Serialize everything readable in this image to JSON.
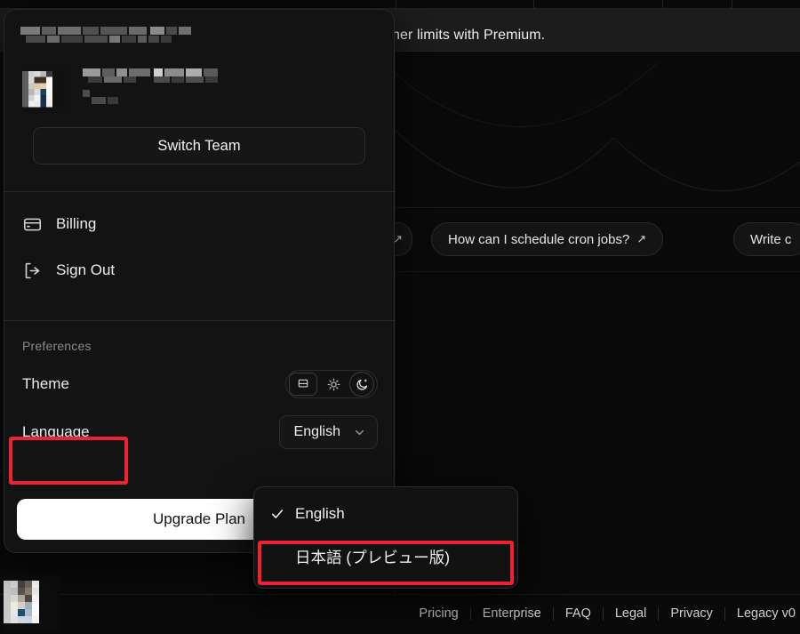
{
  "app": {
    "banner_text": "gher limits with Premium.",
    "suggestion_chips": [
      {
        "label": "",
        "icon": "arrow-up-right-icon"
      },
      {
        "label": "How can I schedule cron jobs?",
        "icon": "arrow-up-right-icon"
      },
      {
        "label": "Write c",
        "icon": ""
      }
    ]
  },
  "account_panel": {
    "team_name_redacted": "",
    "user_name_redacted": "",
    "user_email_redacted": "",
    "switch_team_label": "Switch Team",
    "menu_items": [
      {
        "label": "Billing",
        "icon": "credit-card-icon"
      },
      {
        "label": "Sign Out",
        "icon": "sign-out-icon"
      }
    ],
    "preferences_heading": "Preferences",
    "theme": {
      "label": "Theme",
      "options": [
        {
          "name": "system",
          "icon": "monitor-icon"
        },
        {
          "name": "light",
          "icon": "sun-icon"
        },
        {
          "name": "dark",
          "icon": "moon-icon"
        }
      ],
      "selected": "dark"
    },
    "language": {
      "label": "Language",
      "selected": "English",
      "chevron_icon": "chevron-down-icon"
    },
    "upgrade_label": "Upgrade Plan"
  },
  "language_menu": {
    "options": [
      {
        "label": "English",
        "checked": true,
        "check_icon": "check-icon"
      },
      {
        "label": "日本語 (プレビュー版)",
        "checked": false,
        "check_icon": ""
      }
    ]
  },
  "footer": {
    "links": [
      "Pricing",
      "Enterprise",
      "FAQ",
      "Legal",
      "Privacy",
      "Legacy v0"
    ]
  },
  "annotations": {
    "box_color": "#ef2233",
    "highlighted": [
      "Language",
      "日本語 (プレビュー版)"
    ]
  }
}
